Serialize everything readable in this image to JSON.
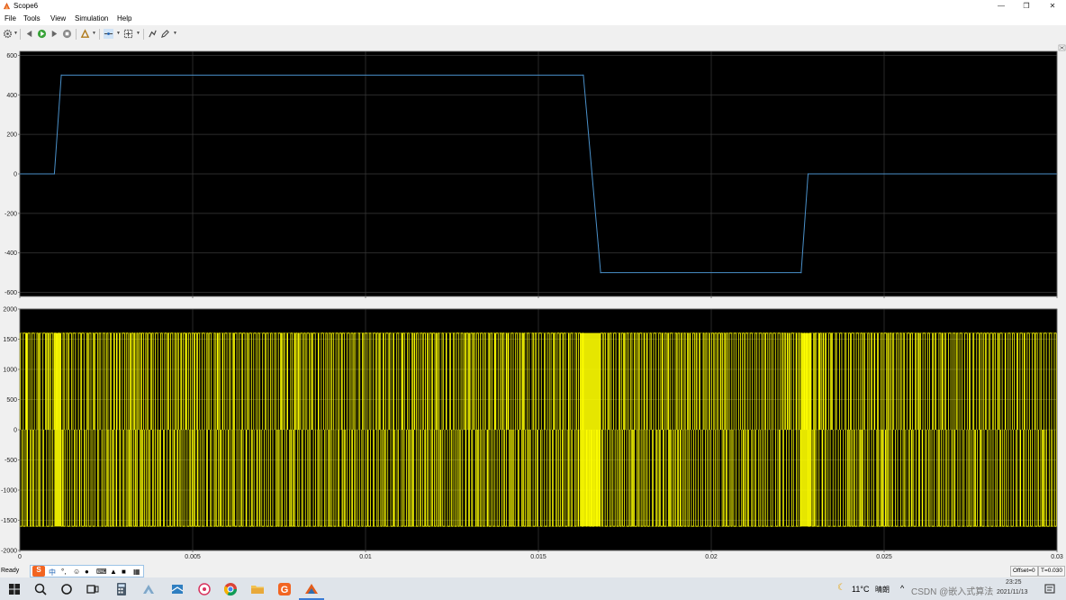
{
  "window": {
    "title": "Scope6",
    "minimize_icon": "minimize-icon",
    "restore_icon": "restore-icon",
    "close_icon": "close-icon"
  },
  "menu": {
    "items": [
      "File",
      "Tools",
      "View",
      "Simulation",
      "Help"
    ]
  },
  "toolbar": {
    "icons": [
      "gear-icon",
      "step-back-icon",
      "run-icon",
      "step-forward-icon",
      "stop-icon",
      "highlight-icon",
      "cursor-measure-icon",
      "zoom-icon",
      "autoscale-icon",
      "pen-icon"
    ]
  },
  "colors": {
    "plot_background": "#000000",
    "figure_background": "#f0f0f0",
    "grid": "#3a3a3a",
    "trace_top": "#4a90c9",
    "trace_bottom": "#ffff00"
  },
  "chart_data": [
    {
      "type": "line",
      "title": "",
      "xlabel": "",
      "ylabel": "",
      "xlim": [
        0,
        0.03
      ],
      "ylim": [
        -620,
        620
      ],
      "yticks": [
        {
          "value": 600,
          "label": "600"
        },
        {
          "value": 400,
          "label": "400"
        },
        {
          "value": 200,
          "label": "200"
        },
        {
          "value": 0,
          "label": "0"
        },
        {
          "value": -200,
          "label": "-200"
        },
        {
          "value": -400,
          "label": "-400"
        },
        {
          "value": -600,
          "label": "-600"
        }
      ],
      "xticks": [
        0,
        0.005,
        0.01,
        0.015,
        0.02,
        0.025,
        0.03
      ],
      "grid": true,
      "series": [
        {
          "color": "#4a90c9",
          "points": [
            {
              "x": 0,
              "y": 0
            },
            {
              "x": 0.001,
              "y": 0
            },
            {
              "x": 0.0012,
              "y": 500
            },
            {
              "x": 0.0163,
              "y": 500
            },
            {
              "x": 0.0168,
              "y": -500
            },
            {
              "x": 0.0226,
              "y": -500
            },
            {
              "x": 0.0228,
              "y": 0
            },
            {
              "x": 0.03,
              "y": 0
            }
          ]
        }
      ]
    },
    {
      "type": "line",
      "title": "",
      "xlabel": "",
      "ylabel": "",
      "xlim": [
        0,
        0.03
      ],
      "ylim": [
        -2000,
        2000
      ],
      "yticks": [
        {
          "value": 2000,
          "label": "2000"
        },
        {
          "value": 1500,
          "label": "1500"
        },
        {
          "value": 1000,
          "label": "1000"
        },
        {
          "value": 500,
          "label": "500"
        },
        {
          "value": 0,
          "label": "0"
        },
        {
          "value": -500,
          "label": "-500"
        },
        {
          "value": -1000,
          "label": "-1000"
        },
        {
          "value": -1500,
          "label": "-1500"
        },
        {
          "value": -2000,
          "label": "-2000"
        }
      ],
      "xticks": [
        {
          "value": 0,
          "label": "0"
        },
        {
          "value": 0.005,
          "label": "0.005"
        },
        {
          "value": 0.01,
          "label": "0.01"
        },
        {
          "value": 0.015,
          "label": "0.015"
        },
        {
          "value": 0.02,
          "label": "0.02"
        },
        {
          "value": 0.025,
          "label": "0.025"
        },
        {
          "value": 0.03,
          "label": "0.03"
        }
      ],
      "grid": true,
      "series": [
        {
          "color": "#ffff00",
          "levels": [
            1600,
            -1600
          ],
          "positive_bursts": [
            [
              0,
              0.0163
            ],
            [
              0.0168,
              0.03
            ]
          ],
          "negative_bursts": [
            [
              0,
              0.001
            ],
            [
              0.0012,
              0.0226
            ],
            [
              0.0228,
              0.03
            ]
          ],
          "dense_bands": [
            [
              0.001,
              0.0012
            ],
            [
              0.0162,
              0.0168
            ],
            [
              0.0226,
              0.0229
            ]
          ]
        }
      ]
    }
  ],
  "status": {
    "text": "Ready",
    "offset": "Offset=0",
    "time": "T=0.030"
  },
  "ime": {
    "chinese_label": "中"
  },
  "taskbar": {
    "icons": [
      "windows-start-icon",
      "search-icon",
      "cortana-icon",
      "task-view-icon",
      "calculator-icon",
      "app-icon",
      "app-icon",
      "app-icon",
      "chrome-icon",
      "file-explorer-icon",
      "app-icon",
      "matlab-icon"
    ],
    "weather_temp": "11°C",
    "weather_desc": "晴朗",
    "watermark": "CSDN @嵌入式算法",
    "time": "23:25",
    "date": "2021/11/13"
  }
}
